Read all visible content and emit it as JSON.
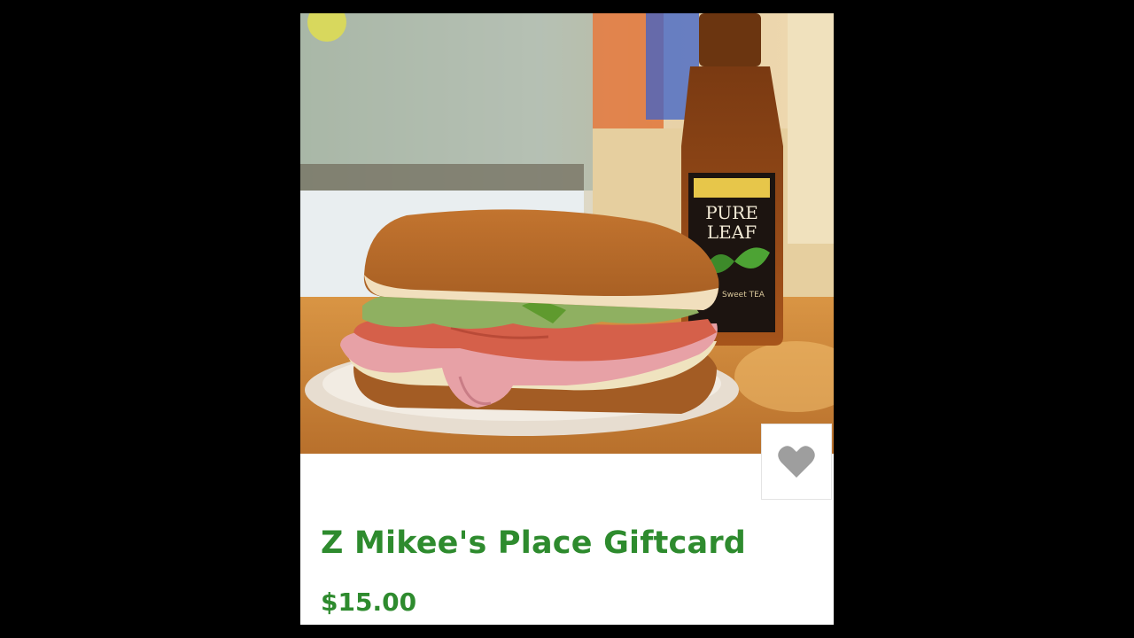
{
  "product": {
    "title": "Z Mikee's Place Giftcard",
    "price": "$15.00",
    "image": "sandwich-and-pure-leaf-tea-photo",
    "bottle_label_line1": "PURE",
    "bottle_label_line2": "LEAF",
    "bottle_sub_label": "Sweet TEA"
  },
  "favorite": {
    "icon": "heart-icon",
    "color": "#9e9e9e"
  },
  "colors": {
    "accent": "#2e8b2e",
    "background": "#000000",
    "card": "#ffffff"
  }
}
